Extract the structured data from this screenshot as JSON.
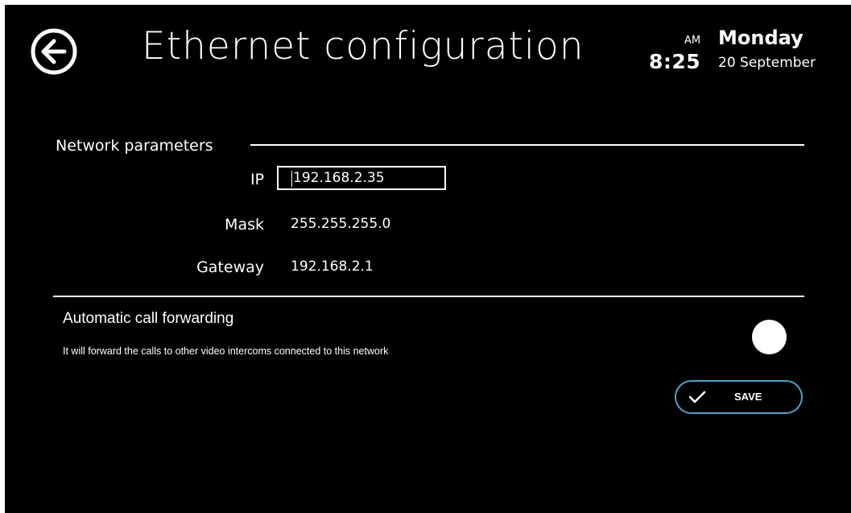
{
  "header": {
    "title": "Ethernet configuration",
    "back_icon": "arrow-left-circle-icon"
  },
  "clock": {
    "ampm": "AM",
    "time": "8:25",
    "day": "Monday",
    "date": "20 September"
  },
  "network": {
    "section_title": "Network parameters",
    "ip_label": "IP",
    "ip_value": "192.168.2.35",
    "mask_label": "Mask",
    "mask_value": "255.255.255.0",
    "gateway_label": "Gateway",
    "gateway_value": "192.168.2.1"
  },
  "forwarding": {
    "title": "Automatic call forwarding",
    "description": "It will forward the calls to other video intercoms connected to this network"
  },
  "save": {
    "label": "SAVE",
    "icon": "checkmark-icon"
  },
  "colors": {
    "background": "#000000",
    "text": "#ffffff",
    "save_border": "#4fa0c8"
  }
}
